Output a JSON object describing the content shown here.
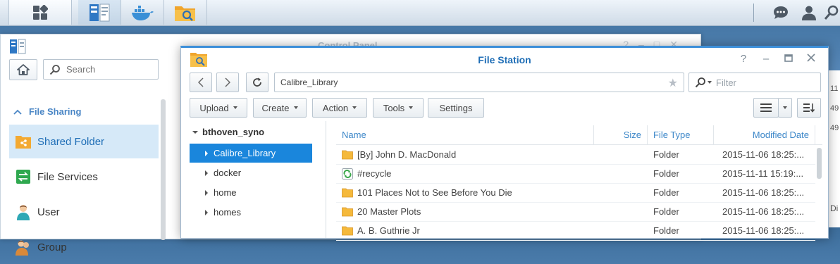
{
  "taskbar": {
    "main_icon": "main-menu-grid-icon",
    "apps": [
      "control-panel-icon",
      "docker-icon",
      "file-station-icon"
    ],
    "right_icons": [
      "chat-icon",
      "user-icon",
      "search-icon"
    ]
  },
  "control_panel": {
    "title": "Control Panel",
    "search_placeholder": "Search",
    "section": "File Sharing",
    "items": [
      {
        "label": "Shared Folder",
        "icon": "shared-folder-icon"
      },
      {
        "label": "File Services",
        "icon": "file-services-icon"
      },
      {
        "label": "User",
        "icon": "user-icon"
      },
      {
        "label": "Group",
        "icon": "group-icon"
      }
    ],
    "edge_texts": [
      "11",
      "49",
      "49",
      "Di"
    ]
  },
  "file_station": {
    "title": "File Station",
    "path": "Calibre_Library",
    "filter_placeholder": "Filter",
    "toolbar": {
      "upload": "Upload",
      "create": "Create",
      "action": "Action",
      "tools": "Tools",
      "settings": "Settings"
    },
    "tree": {
      "root": "bthoven_syno",
      "nodes": [
        "Calibre_Library",
        "docker",
        "home",
        "homes"
      ]
    },
    "columns": {
      "name": "Name",
      "size": "Size",
      "type": "File Type",
      "modified": "Modified Date"
    },
    "rows": [
      {
        "name": "[By] John D. MacDonald",
        "type": "Folder",
        "modified": "2015-11-06 18:25:..."
      },
      {
        "name": "#recycle",
        "type": "Folder",
        "modified": "2015-11-11 15:19:..."
      },
      {
        "name": "101 Places Not to See Before You Die",
        "type": "Folder",
        "modified": "2015-11-06 18:25:..."
      },
      {
        "name": "20 Master Plots",
        "type": "Folder",
        "modified": "2015-11-06 18:25:..."
      },
      {
        "name": "A. B. Guthrie Jr",
        "type": "Folder",
        "modified": "2015-11-06 18:25:..."
      }
    ]
  },
  "colors": {
    "accent": "#1a86dc",
    "header_text": "#3b86c8",
    "selected_bg": "#d6e9f8",
    "folder": "#f5b93b"
  }
}
